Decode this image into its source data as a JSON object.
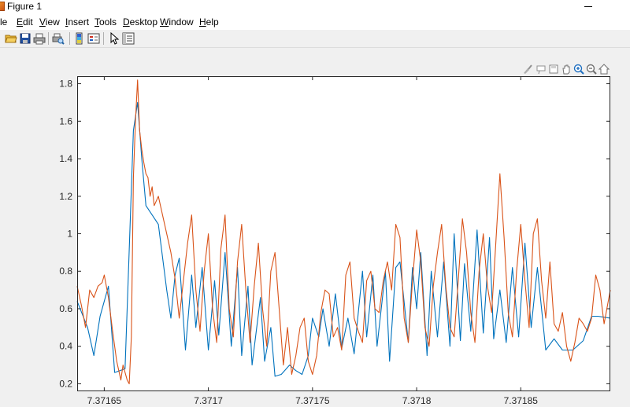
{
  "window": {
    "title": "Figure 1"
  },
  "menubar": {
    "items": [
      {
        "label": "le",
        "u": ""
      },
      {
        "label": "dit",
        "u": "E"
      },
      {
        "label": "iew",
        "u": "V"
      },
      {
        "label": "nsert",
        "u": "I"
      },
      {
        "label": "ools",
        "u": "T"
      },
      {
        "label": "esktop",
        "u": "D"
      },
      {
        "label": "indow",
        "u": "W"
      },
      {
        "label": "elp",
        "u": "H"
      }
    ]
  },
  "toolbar": {
    "icons": [
      "open-folder-icon",
      "save-icon",
      "print-icon",
      "print-preview-icon",
      "colorbar-icon",
      "legend-icon",
      "pointer-icon",
      "property-editor-icon"
    ]
  },
  "axes_toolbar": {
    "icons": [
      "brush-icon",
      "data-tips-icon",
      "save-axes-icon",
      "pan-icon",
      "zoom-in-icon",
      "zoom-out-icon",
      "home-icon"
    ]
  },
  "chart_data": {
    "type": "line",
    "xlim": [
      7.371637,
      7.371893
    ],
    "ylim": [
      0.16,
      1.84
    ],
    "xticks": [
      7.37165,
      7.3717,
      7.37175,
      7.3718,
      7.37185
    ],
    "xtick_labels": [
      "7.37165",
      "7.3717",
      "7.37175",
      "7.3718",
      "7.37185"
    ],
    "yticks": [
      0.2,
      0.4,
      0.6,
      0.8,
      1.0,
      1.2,
      1.4,
      1.6,
      1.8
    ],
    "ytick_labels": [
      "0.2",
      "0.4",
      "0.6",
      "0.8",
      "1",
      "1.2",
      "1.4",
      "1.6",
      "1.8"
    ],
    "series": [
      {
        "color": "#0072BD",
        "x": [
          7.371637,
          7.371642,
          7.371645,
          7.371648,
          7.371652,
          7.371655,
          7.37166,
          7.371664,
          7.371666,
          7.371668,
          7.37167,
          7.371673,
          7.371676,
          7.37168,
          7.371682,
          7.371684,
          7.371686,
          7.371689,
          7.371692,
          7.371694,
          7.371697,
          7.3717,
          7.371703,
          7.371705,
          7.371708,
          7.371711,
          7.371714,
          7.371716,
          7.371719,
          7.371721,
          7.371725,
          7.371727,
          7.37173,
          7.371732,
          7.371735,
          7.371739,
          7.371742,
          7.371745,
          7.371748,
          7.37175,
          7.371753,
          7.371755,
          7.371758,
          7.371761,
          7.371764,
          7.371767,
          7.37177,
          7.371774,
          7.371776,
          7.371779,
          7.371781,
          7.371785,
          7.371787,
          7.37179,
          7.371792,
          7.371796,
          7.371798,
          7.3718,
          7.371802,
          7.371805,
          7.371807,
          7.37181,
          7.371813,
          7.371816,
          7.371818,
          7.371821,
          7.371823,
          7.371826,
          7.371829,
          7.371832,
          7.371835,
          7.371837,
          7.37184,
          7.371843,
          7.371846,
          7.371849,
          7.371852,
          7.371855,
          7.371858,
          7.371862,
          7.371866,
          7.37187,
          7.371873,
          7.371875,
          7.37188,
          7.371884,
          7.371887,
          7.371893
        ],
        "y": [
          0.64,
          0.5,
          0.35,
          0.56,
          0.72,
          0.26,
          0.28,
          1.55,
          1.7,
          1.4,
          1.15,
          1.1,
          1.05,
          0.7,
          0.55,
          0.78,
          0.87,
          0.38,
          0.78,
          0.5,
          0.82,
          0.38,
          0.75,
          0.46,
          0.9,
          0.4,
          0.82,
          0.35,
          0.72,
          0.3,
          0.66,
          0.32,
          0.5,
          0.24,
          0.25,
          0.3,
          0.27,
          0.25,
          0.35,
          0.55,
          0.45,
          0.6,
          0.4,
          0.68,
          0.39,
          0.55,
          0.36,
          0.8,
          0.45,
          0.78,
          0.4,
          0.8,
          0.32,
          0.82,
          0.85,
          0.42,
          0.82,
          0.6,
          0.9,
          0.35,
          0.8,
          0.45,
          0.85,
          0.4,
          1.0,
          0.43,
          0.84,
          0.48,
          1.02,
          0.47,
          0.98,
          0.44,
          0.7,
          0.42,
          0.82,
          0.45,
          0.95,
          0.5,
          0.82,
          0.38,
          0.44,
          0.38,
          0.38,
          0.38,
          0.43,
          0.56,
          0.56,
          0.55
        ]
      },
      {
        "color": "#D95319",
        "x": [
          7.371637,
          7.371639,
          7.371641,
          7.371643,
          7.371645,
          7.371647,
          7.371649,
          7.37165,
          7.371652,
          7.371654,
          7.371656,
          7.371658,
          7.371659,
          7.371661,
          7.371662,
          7.371663,
          7.371664,
          7.371665,
          7.371666,
          7.371667,
          7.371668,
          7.371669,
          7.37167,
          7.371671,
          7.371672,
          7.371673,
          7.371674,
          7.371676,
          7.371678,
          7.37168,
          7.371682,
          7.371684,
          7.371686,
          7.371688,
          7.37169,
          7.371692,
          7.371694,
          7.371696,
          7.371698,
          7.3717,
          7.371702,
          7.371704,
          7.371706,
          7.371708,
          7.37171,
          7.371712,
          7.371714,
          7.371716,
          7.371718,
          7.37172,
          7.371722,
          7.371724,
          7.371726,
          7.371728,
          7.37173,
          7.371732,
          7.371734,
          7.371736,
          7.371738,
          7.37174,
          7.371742,
          7.371744,
          7.371746,
          7.371748,
          7.37175,
          7.371752,
          7.371754,
          7.371756,
          7.371758,
          7.37176,
          7.371762,
          7.371764,
          7.371766,
          7.371768,
          7.37177,
          7.371772,
          7.371774,
          7.371776,
          7.371778,
          7.37178,
          7.371782,
          7.371784,
          7.371786,
          7.371788,
          7.37179,
          7.371792,
          7.371794,
          7.371796,
          7.371798,
          7.3718,
          7.371802,
          7.371804,
          7.371806,
          7.371808,
          7.37181,
          7.371812,
          7.371814,
          7.371816,
          7.371818,
          7.37182,
          7.371822,
          7.371824,
          7.371826,
          7.371828,
          7.37183,
          7.371832,
          7.371834,
          7.371836,
          7.371838,
          7.37184,
          7.371842,
          7.371844,
          7.371846,
          7.371848,
          7.37185,
          7.371852,
          7.371854,
          7.371856,
          7.371858,
          7.37186,
          7.371862,
          7.371864,
          7.371866,
          7.371868,
          7.37187,
          7.371872,
          7.371874,
          7.371876,
          7.371878,
          7.37188,
          7.371882,
          7.371884,
          7.371886,
          7.371888,
          7.37189,
          7.371893
        ],
        "y": [
          0.72,
          0.62,
          0.5,
          0.7,
          0.66,
          0.72,
          0.74,
          0.78,
          0.66,
          0.48,
          0.32,
          0.22,
          0.3,
          0.22,
          0.2,
          0.45,
          1.3,
          1.6,
          1.82,
          1.55,
          1.45,
          1.38,
          1.32,
          1.3,
          1.2,
          1.25,
          1.15,
          1.2,
          1.1,
          1.0,
          0.9,
          0.76,
          0.55,
          0.75,
          0.95,
          1.1,
          0.7,
          0.48,
          0.8,
          1.0,
          0.6,
          0.42,
          0.92,
          1.1,
          0.6,
          0.45,
          0.85,
          1.05,
          0.7,
          0.42,
          0.72,
          0.95,
          0.6,
          0.4,
          0.8,
          0.9,
          0.6,
          0.3,
          0.5,
          0.25,
          0.35,
          0.5,
          0.55,
          0.32,
          0.25,
          0.35,
          0.58,
          0.7,
          0.68,
          0.45,
          0.5,
          0.38,
          0.78,
          0.85,
          0.55,
          0.48,
          0.42,
          0.75,
          0.8,
          0.6,
          0.58,
          0.75,
          0.85,
          0.7,
          1.05,
          0.98,
          0.55,
          0.42,
          0.75,
          1.02,
          0.85,
          0.5,
          0.4,
          0.72,
          0.9,
          1.05,
          0.72,
          0.5,
          0.45,
          0.75,
          1.08,
          0.9,
          0.58,
          0.42,
          0.8,
          1.0,
          0.72,
          0.58,
          0.95,
          1.32,
          0.98,
          0.58,
          0.45,
          0.8,
          1.05,
          0.75,
          0.5,
          1.0,
          1.08,
          0.75,
          0.55,
          0.85,
          0.52,
          0.48,
          0.58,
          0.4,
          0.32,
          0.42,
          0.55,
          0.52,
          0.48,
          0.55,
          0.78,
          0.7,
          0.52,
          0.7
        ]
      }
    ]
  }
}
